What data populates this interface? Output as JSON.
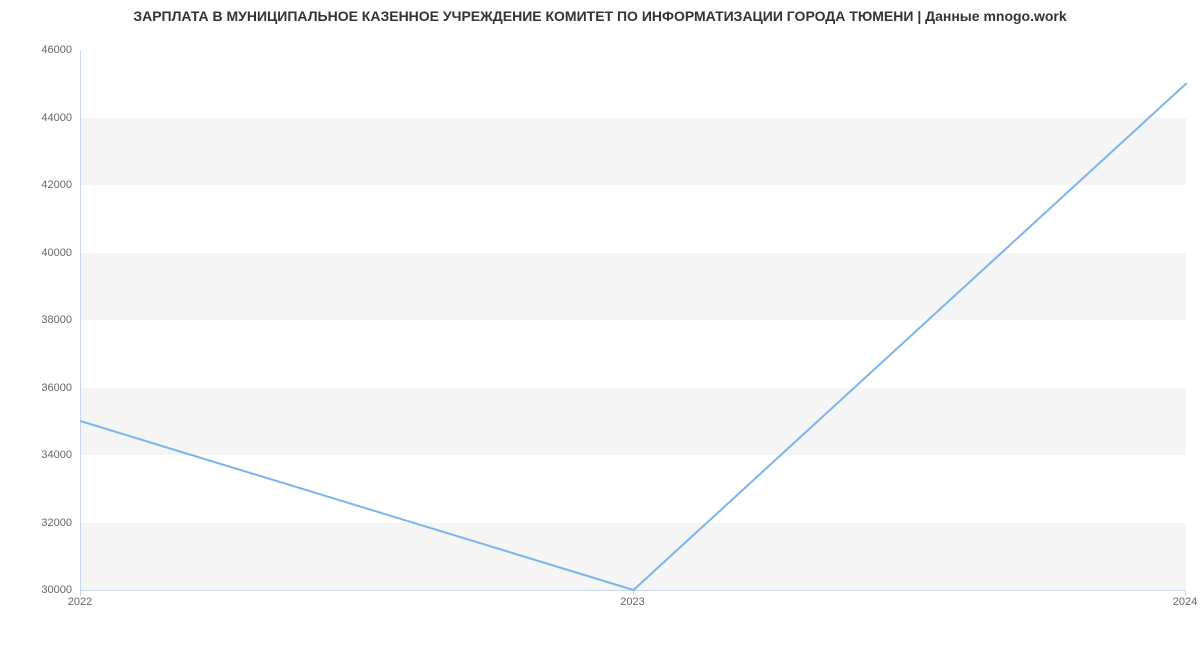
{
  "chart_data": {
    "type": "line",
    "title": "ЗАРПЛАТА В МУНИЦИПАЛЬНОЕ КАЗЕННОЕ УЧРЕЖДЕНИЕ КОМИТЕТ ПО ИНФОРМАТИЗАЦИИ ГОРОДА ТЮМЕНИ | Данные mnogo.work",
    "x": [
      2022,
      2023,
      2024
    ],
    "values": [
      35000,
      30000,
      45000
    ],
    "x_ticks": [
      2022,
      2023,
      2024
    ],
    "y_ticks": [
      30000,
      32000,
      34000,
      36000,
      38000,
      40000,
      42000,
      44000,
      46000
    ],
    "xlim": [
      2022,
      2024
    ],
    "ylim": [
      30000,
      46000
    ],
    "xlabel": "",
    "ylabel": "",
    "line_color": "#7cb5ec",
    "band_color": "#f5f5f5"
  }
}
